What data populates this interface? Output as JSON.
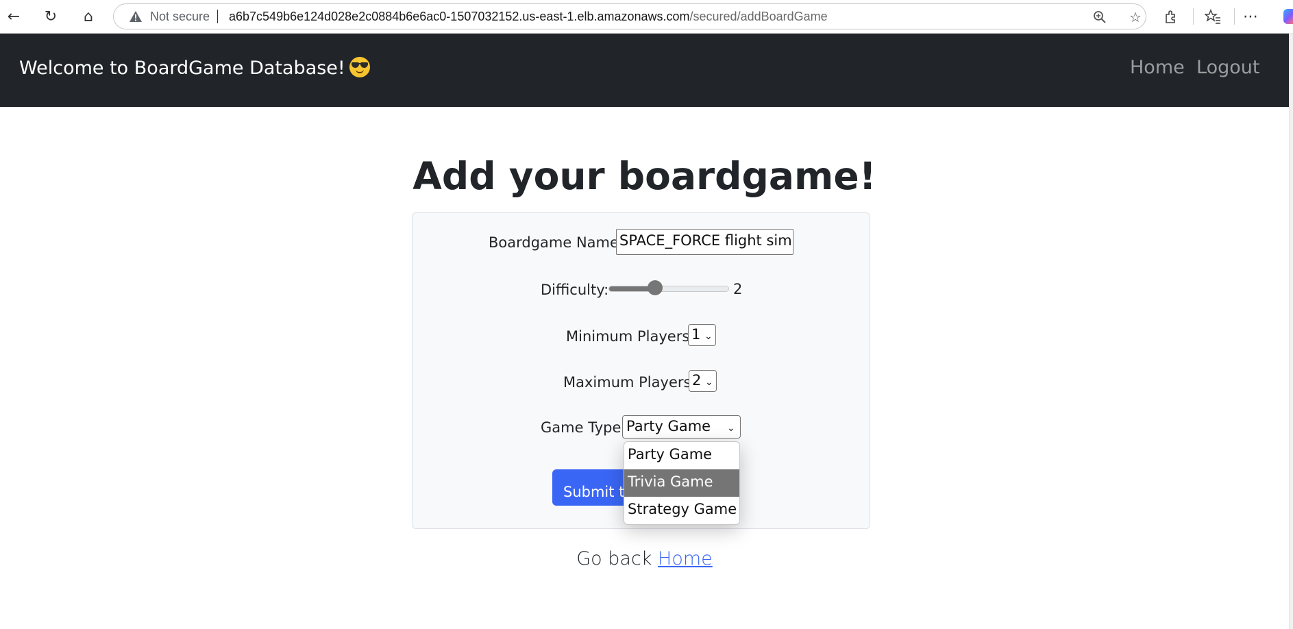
{
  "browser": {
    "security_label": "Not secure",
    "url_host": "a6b7c549b6e124d028e2c0884b6e6ac0-1507032152.us-east-1.elb.amazonaws.com",
    "url_path": "/secured/addBoardGame"
  },
  "navbar": {
    "brand": "Welcome to BoardGame Database!",
    "brand_emoji": "smiling-face-with-sunglasses",
    "links": {
      "home": "Home",
      "logout": "Logout"
    },
    "background_color": "#212529"
  },
  "page": {
    "title": "Add your boardgame!"
  },
  "form": {
    "name_label": "Boardgame Name:",
    "name_value": "SPACE_FORCE flight simul",
    "difficulty_label": "Difficulty:",
    "difficulty_value": "2",
    "difficulty_level": 0.25,
    "min_players_label": "Minimum Players:",
    "min_players_value": "1",
    "max_players_label": "Maximum Players:",
    "max_players_value": "2",
    "game_type_label": "Game Type:",
    "game_type_value": "Party Game",
    "game_type_options": [
      "Party Game",
      "Trivia Game",
      "Strategy Game"
    ],
    "highlighted_option": "Trivia Game",
    "submit_label": "Submit the boardgame",
    "accent_color": "#3a66f5"
  },
  "footer": {
    "goback_text": "Go back",
    "goback_link": "Home"
  }
}
